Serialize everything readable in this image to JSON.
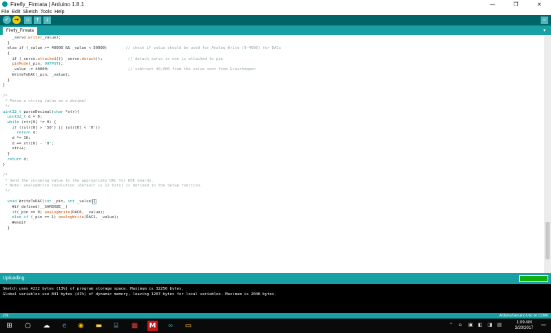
{
  "window": {
    "title": "Firefly_Firmata | Arduino 1.8.1",
    "minimize_glyph": "—",
    "maximize_glyph": "❐",
    "close_glyph": "✕"
  },
  "menu": [
    "File",
    "Edit",
    "Sketch",
    "Tools",
    "Help"
  ],
  "toolbar": {
    "verify": "✓",
    "upload": "→",
    "new": "▫",
    "open": "↑",
    "save": "↓",
    "serial": "⌕",
    "accent": "#006468",
    "tab_accent": "#17a1a5"
  },
  "tabs": [
    {
      "label": "Firefly_Firmata"
    }
  ],
  "tab_menu_glyph": "▾",
  "code_lines": [
    [
      [
        "    _servo.",
        "t"
      ],
      [
        "write",
        "f"
      ],
      [
        "(_value);",
        "t"
      ]
    ],
    [
      [
        "  }",
        "t"
      ]
    ],
    [
      [
        "  else if (_value >= 40000 && _value < 50000)        ",
        "t"
      ],
      [
        "// check if value should be used for Analog Write (0-4096) for DACs",
        "c"
      ]
    ],
    [
      [
        "  {",
        "t"
      ]
    ],
    [
      [
        "    if (_servo.",
        "t"
      ],
      [
        "attached",
        "f"
      ],
      [
        "()) _servo.",
        "t"
      ],
      [
        "detach",
        "f"
      ],
      [
        "();           ",
        "t"
      ],
      [
        "// detach servo is one is attached to pin",
        "c"
      ]
    ],
    [
      [
        "    ",
        "t"
      ],
      [
        "pinMode",
        "f"
      ],
      [
        "(_pin, ",
        "t"
      ],
      [
        "OUTPUT",
        "k"
      ],
      [
        ");",
        "t"
      ]
    ],
    [
      [
        "    _value -= 40000;                                  ",
        "t"
      ],
      [
        "// subtract 40,000 from the value sent from Grasshopper",
        "c"
      ]
    ],
    [
      [
        "    WriteToDAC(_pin, _value);",
        "t"
      ]
    ],
    [
      [
        "  }",
        "t"
      ]
    ],
    [
      [
        "}",
        "t"
      ]
    ],
    [
      [
        "",
        "t"
      ]
    ],
    [
      [
        "/*",
        "c"
      ]
    ],
    [
      [
        " * Parse a string value as a decimal",
        "c"
      ]
    ],
    [
      [
        " */",
        "c"
      ]
    ],
    [
      [
        "uint32_t",
        "k"
      ],
      [
        " parseDecimal(",
        "t"
      ],
      [
        "char",
        "k"
      ],
      [
        " *str){",
        "t"
      ]
    ],
    [
      [
        "  ",
        "t"
      ],
      [
        "uint32_t",
        "k"
      ],
      [
        " d = 0;",
        "t"
      ]
    ],
    [
      [
        "  ",
        "t"
      ],
      [
        "while",
        "k"
      ],
      [
        " (str[0] != 0) {",
        "t"
      ]
    ],
    [
      [
        "    ",
        "t"
      ],
      [
        "if",
        "k"
      ],
      [
        " ((str[0] > '50') || (str[0] < '0'))",
        "t"
      ]
    ],
    [
      [
        "      ",
        "t"
      ],
      [
        "return",
        "k"
      ],
      [
        " d;",
        "t"
      ]
    ],
    [
      [
        "    d *= 10;",
        "t"
      ]
    ],
    [
      [
        "    d += str[0] - ",
        "t"
      ],
      [
        "'0'",
        "s"
      ],
      [
        ";",
        "t"
      ]
    ],
    [
      [
        "    str++;",
        "t"
      ]
    ],
    [
      [
        "  }",
        "t"
      ]
    ],
    [
      [
        "  ",
        "t"
      ],
      [
        "return",
        "k"
      ],
      [
        " d;",
        "t"
      ]
    ],
    [
      [
        "}",
        "t"
      ]
    ],
    [
      [
        "",
        "t"
      ]
    ],
    [
      [
        "/*",
        "c"
      ]
    ],
    [
      [
        " * Send the incoming value to the appropriate DAC for DUE boards.",
        "c"
      ]
    ],
    [
      [
        " * Note: analogWrite resolution (default is 12 bits) is defined in the Setup function.",
        "c"
      ]
    ],
    [
      [
        " */",
        "c"
      ]
    ],
    [
      [
        "",
        "t"
      ]
    ],
    [
      [
        "  ",
        "t"
      ],
      [
        "void",
        "k"
      ],
      [
        " WriteToDAC(",
        "t"
      ],
      [
        "int",
        "k"
      ],
      [
        " _pin, ",
        "t"
      ],
      [
        "int",
        "k"
      ],
      [
        " _value)",
        "t"
      ],
      [
        "{",
        "b"
      ]
    ],
    [
      [
        "    #if defined(__SAM3X8E__)",
        "t"
      ]
    ],
    [
      [
        "    ",
        "t"
      ],
      [
        "if",
        "k"
      ],
      [
        "(_pin == 0) ",
        "t"
      ],
      [
        "analogWrite",
        "f"
      ],
      [
        "(DAC0, _value);",
        "t"
      ]
    ],
    [
      [
        "    ",
        "t"
      ],
      [
        "else if",
        "k"
      ],
      [
        " (_pin == 1) ",
        "t"
      ],
      [
        "analogWrite",
        "f"
      ],
      [
        "(DAC1, _value);",
        "t"
      ]
    ],
    [
      [
        "    #endif",
        "t"
      ]
    ],
    [
      [
        "  }",
        "t"
      ]
    ]
  ],
  "status": {
    "text": "Uploading",
    "progress": 1.0
  },
  "console": [
    "Sketch uses 4222 bytes (13%) of program storage space. Maximum is 32256 bytes.",
    "Global variables use 841 bytes (41%) of dynamic memory, leaving 1207 bytes for local variables. Maximum is 2048 bytes."
  ],
  "footer": {
    "line": "239",
    "board": "Arduino/Genuino Uno on COM6"
  },
  "taskbar": {
    "start": "⊞",
    "search": "○",
    "taskview": "▭",
    "onedrive": "☁",
    "edge": "e",
    "chrome": "◉",
    "notes": "▬",
    "files": "⌸",
    "app1": "▦",
    "acrobat": "M",
    "arduino": "∞",
    "explorer": "▭",
    "tray": [
      "⌃",
      "⌂",
      "▣",
      "◧",
      "◨",
      "▤",
      "◫",
      "♪",
      "✉"
    ],
    "clock_time": "1:09 AM",
    "clock_date": "3/20/2017",
    "notif": "▭"
  }
}
